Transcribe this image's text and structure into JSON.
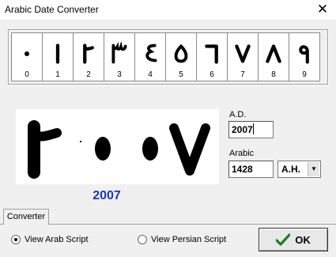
{
  "window": {
    "title": "Arabic Date Converter",
    "close_glyph": "✕"
  },
  "digit_keys": [
    {
      "label": "0",
      "glyph": "zero"
    },
    {
      "label": "1",
      "glyph": "one"
    },
    {
      "label": "2",
      "glyph": "two"
    },
    {
      "label": "3",
      "glyph": "three"
    },
    {
      "label": "4",
      "glyph": "four"
    },
    {
      "label": "5",
      "glyph": "five"
    },
    {
      "label": "6",
      "glyph": "six"
    },
    {
      "label": "7",
      "glyph": "seven"
    },
    {
      "label": "8",
      "glyph": "eight"
    },
    {
      "label": "9",
      "glyph": "nine"
    }
  ],
  "preview": {
    "rendered_digits": [
      "two",
      "zero",
      "zero",
      "seven"
    ],
    "value": "2007"
  },
  "ad_field": {
    "label": "A.D.",
    "value": "2007"
  },
  "arabic_field": {
    "label": "Arabic",
    "value": "1428"
  },
  "era_select": {
    "selected": "A.H."
  },
  "tabs": [
    {
      "label": "Converter",
      "active": true
    }
  ],
  "script_options": [
    {
      "label": "View Arab Script",
      "checked": true
    },
    {
      "label": "View Persian Script",
      "checked": false
    }
  ],
  "ok_button": {
    "label": "OK",
    "icon": "check-icon"
  },
  "colors": {
    "result_text": "#1a35c2",
    "check_icon": "#1e7d1e"
  }
}
